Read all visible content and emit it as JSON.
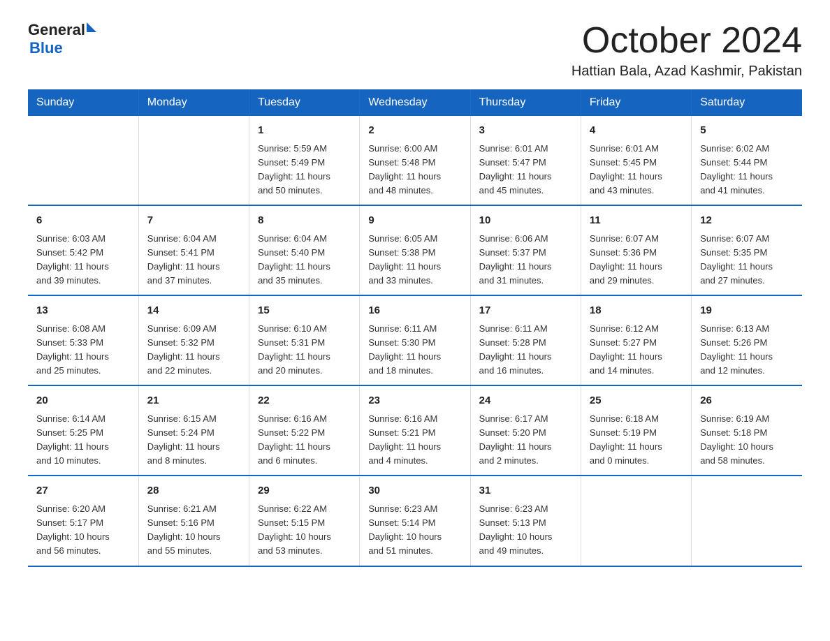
{
  "logo": {
    "general": "General",
    "blue": "Blue"
  },
  "header": {
    "month": "October 2024",
    "location": "Hattian Bala, Azad Kashmir, Pakistan"
  },
  "weekdays": [
    "Sunday",
    "Monday",
    "Tuesday",
    "Wednesday",
    "Thursday",
    "Friday",
    "Saturday"
  ],
  "weeks": [
    [
      {
        "day": "",
        "info": ""
      },
      {
        "day": "",
        "info": ""
      },
      {
        "day": "1",
        "info": "Sunrise: 5:59 AM\nSunset: 5:49 PM\nDaylight: 11 hours\nand 50 minutes."
      },
      {
        "day": "2",
        "info": "Sunrise: 6:00 AM\nSunset: 5:48 PM\nDaylight: 11 hours\nand 48 minutes."
      },
      {
        "day": "3",
        "info": "Sunrise: 6:01 AM\nSunset: 5:47 PM\nDaylight: 11 hours\nand 45 minutes."
      },
      {
        "day": "4",
        "info": "Sunrise: 6:01 AM\nSunset: 5:45 PM\nDaylight: 11 hours\nand 43 minutes."
      },
      {
        "day": "5",
        "info": "Sunrise: 6:02 AM\nSunset: 5:44 PM\nDaylight: 11 hours\nand 41 minutes."
      }
    ],
    [
      {
        "day": "6",
        "info": "Sunrise: 6:03 AM\nSunset: 5:42 PM\nDaylight: 11 hours\nand 39 minutes."
      },
      {
        "day": "7",
        "info": "Sunrise: 6:04 AM\nSunset: 5:41 PM\nDaylight: 11 hours\nand 37 minutes."
      },
      {
        "day": "8",
        "info": "Sunrise: 6:04 AM\nSunset: 5:40 PM\nDaylight: 11 hours\nand 35 minutes."
      },
      {
        "day": "9",
        "info": "Sunrise: 6:05 AM\nSunset: 5:38 PM\nDaylight: 11 hours\nand 33 minutes."
      },
      {
        "day": "10",
        "info": "Sunrise: 6:06 AM\nSunset: 5:37 PM\nDaylight: 11 hours\nand 31 minutes."
      },
      {
        "day": "11",
        "info": "Sunrise: 6:07 AM\nSunset: 5:36 PM\nDaylight: 11 hours\nand 29 minutes."
      },
      {
        "day": "12",
        "info": "Sunrise: 6:07 AM\nSunset: 5:35 PM\nDaylight: 11 hours\nand 27 minutes."
      }
    ],
    [
      {
        "day": "13",
        "info": "Sunrise: 6:08 AM\nSunset: 5:33 PM\nDaylight: 11 hours\nand 25 minutes."
      },
      {
        "day": "14",
        "info": "Sunrise: 6:09 AM\nSunset: 5:32 PM\nDaylight: 11 hours\nand 22 minutes."
      },
      {
        "day": "15",
        "info": "Sunrise: 6:10 AM\nSunset: 5:31 PM\nDaylight: 11 hours\nand 20 minutes."
      },
      {
        "day": "16",
        "info": "Sunrise: 6:11 AM\nSunset: 5:30 PM\nDaylight: 11 hours\nand 18 minutes."
      },
      {
        "day": "17",
        "info": "Sunrise: 6:11 AM\nSunset: 5:28 PM\nDaylight: 11 hours\nand 16 minutes."
      },
      {
        "day": "18",
        "info": "Sunrise: 6:12 AM\nSunset: 5:27 PM\nDaylight: 11 hours\nand 14 minutes."
      },
      {
        "day": "19",
        "info": "Sunrise: 6:13 AM\nSunset: 5:26 PM\nDaylight: 11 hours\nand 12 minutes."
      }
    ],
    [
      {
        "day": "20",
        "info": "Sunrise: 6:14 AM\nSunset: 5:25 PM\nDaylight: 11 hours\nand 10 minutes."
      },
      {
        "day": "21",
        "info": "Sunrise: 6:15 AM\nSunset: 5:24 PM\nDaylight: 11 hours\nand 8 minutes."
      },
      {
        "day": "22",
        "info": "Sunrise: 6:16 AM\nSunset: 5:22 PM\nDaylight: 11 hours\nand 6 minutes."
      },
      {
        "day": "23",
        "info": "Sunrise: 6:16 AM\nSunset: 5:21 PM\nDaylight: 11 hours\nand 4 minutes."
      },
      {
        "day": "24",
        "info": "Sunrise: 6:17 AM\nSunset: 5:20 PM\nDaylight: 11 hours\nand 2 minutes."
      },
      {
        "day": "25",
        "info": "Sunrise: 6:18 AM\nSunset: 5:19 PM\nDaylight: 11 hours\nand 0 minutes."
      },
      {
        "day": "26",
        "info": "Sunrise: 6:19 AM\nSunset: 5:18 PM\nDaylight: 10 hours\nand 58 minutes."
      }
    ],
    [
      {
        "day": "27",
        "info": "Sunrise: 6:20 AM\nSunset: 5:17 PM\nDaylight: 10 hours\nand 56 minutes."
      },
      {
        "day": "28",
        "info": "Sunrise: 6:21 AM\nSunset: 5:16 PM\nDaylight: 10 hours\nand 55 minutes."
      },
      {
        "day": "29",
        "info": "Sunrise: 6:22 AM\nSunset: 5:15 PM\nDaylight: 10 hours\nand 53 minutes."
      },
      {
        "day": "30",
        "info": "Sunrise: 6:23 AM\nSunset: 5:14 PM\nDaylight: 10 hours\nand 51 minutes."
      },
      {
        "day": "31",
        "info": "Sunrise: 6:23 AM\nSunset: 5:13 PM\nDaylight: 10 hours\nand 49 minutes."
      },
      {
        "day": "",
        "info": ""
      },
      {
        "day": "",
        "info": ""
      }
    ]
  ]
}
